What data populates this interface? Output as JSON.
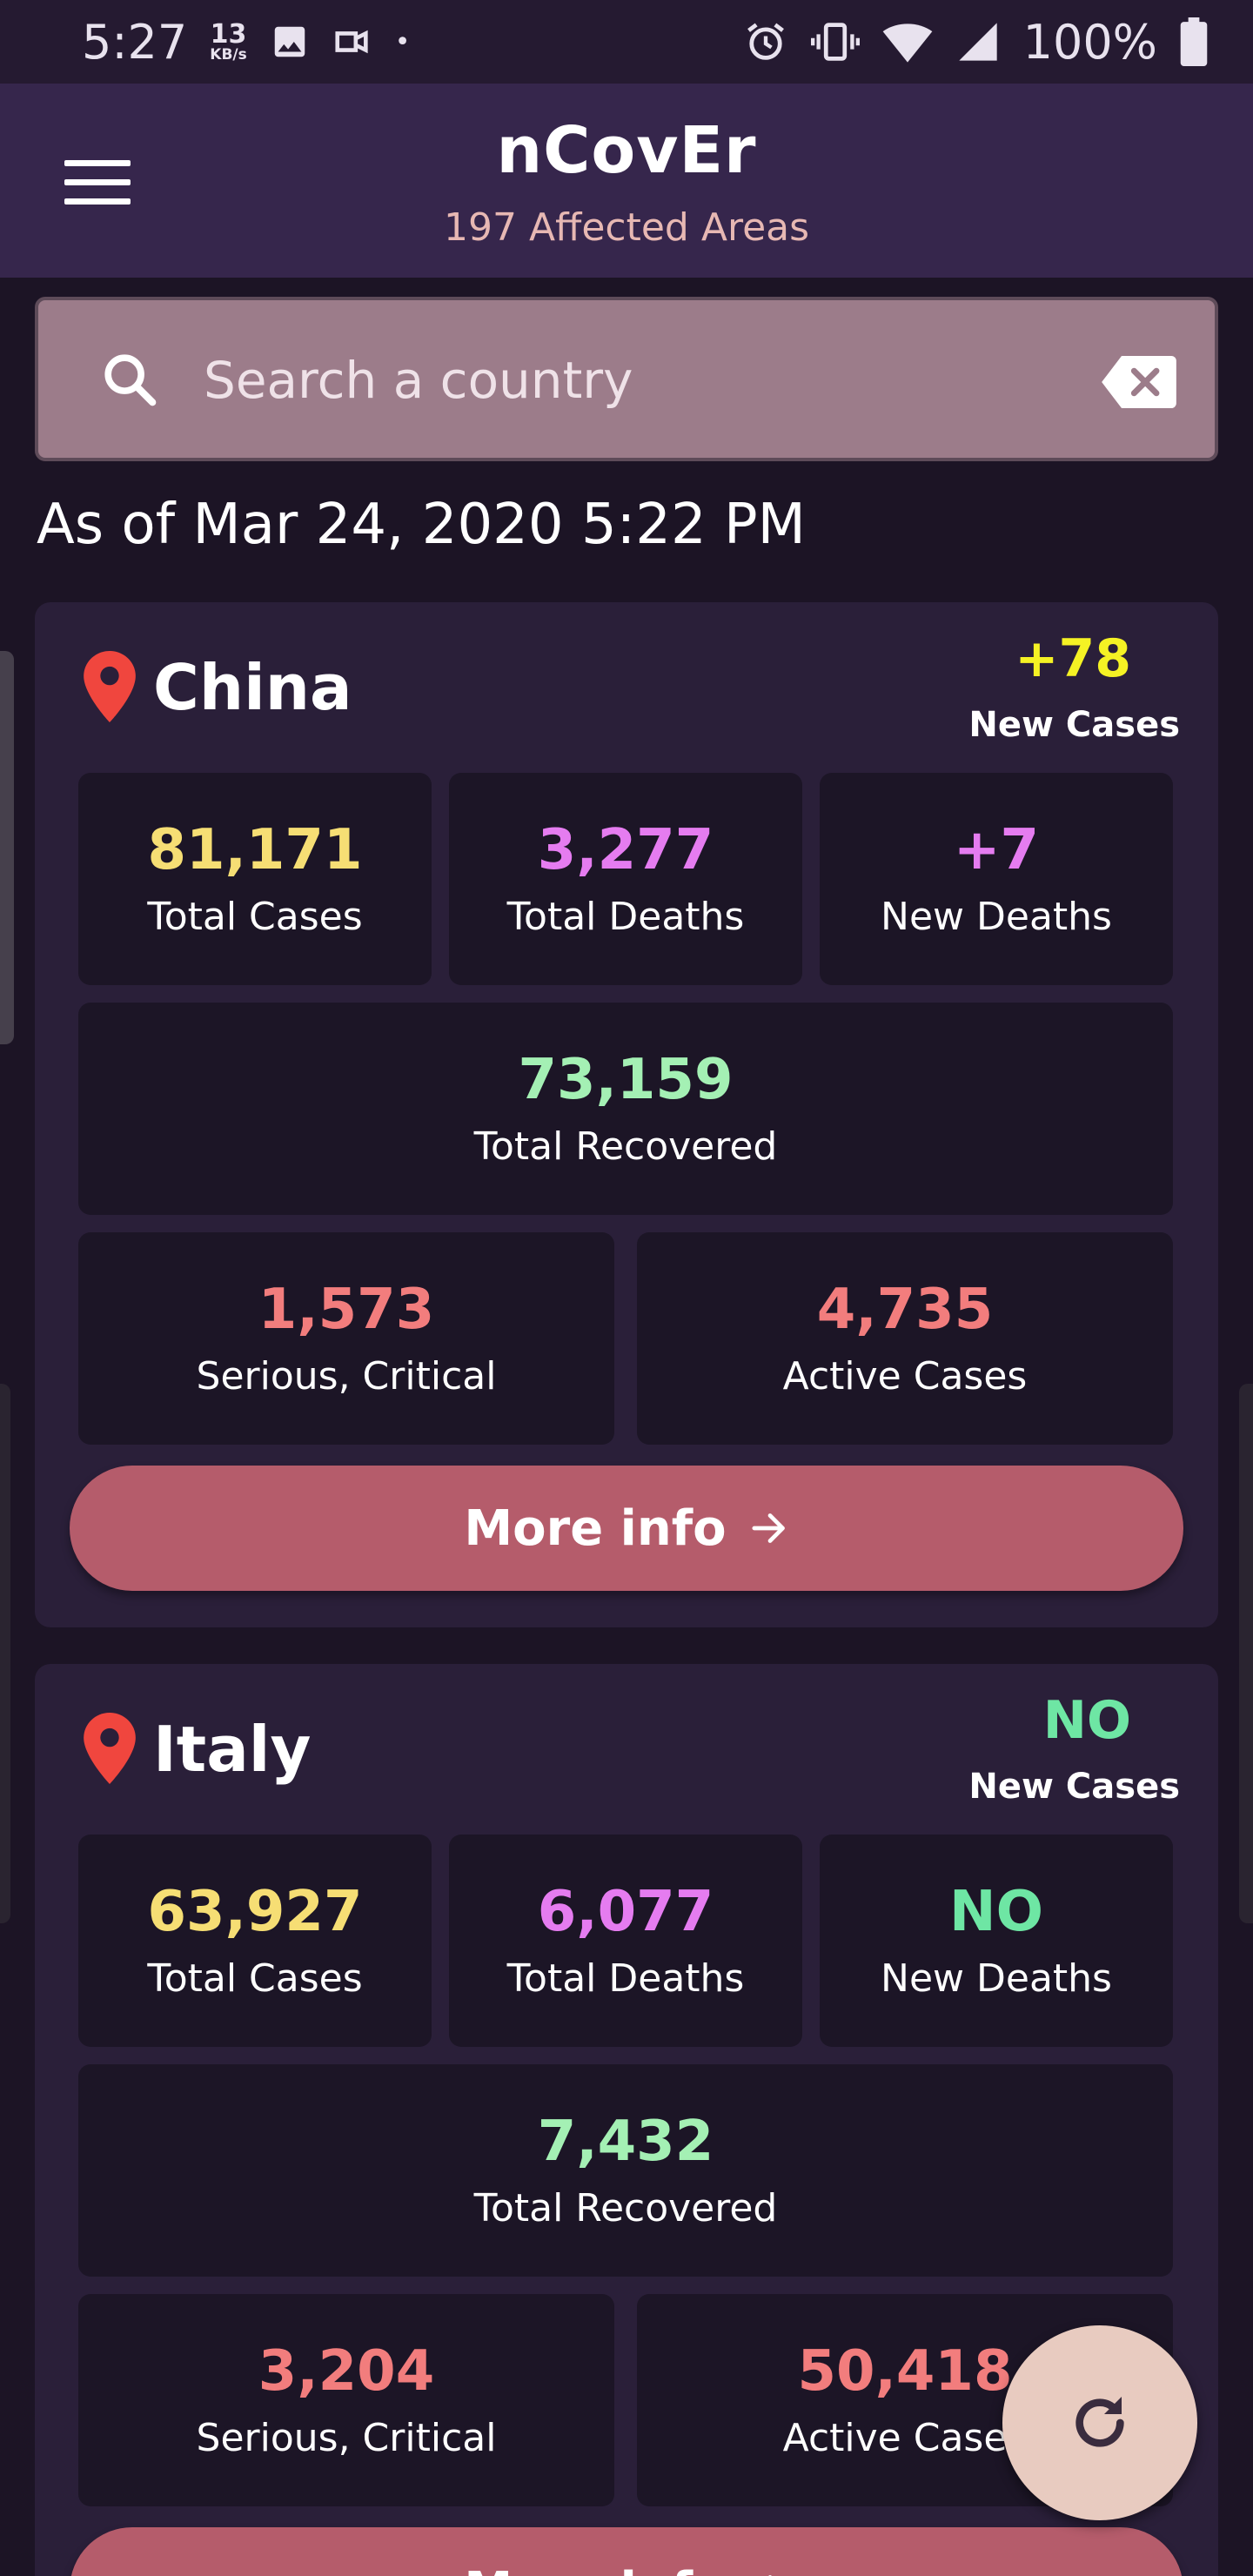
{
  "status_bar": {
    "time": "5:27",
    "speed_value": "13",
    "speed_unit": "KB/s",
    "dot": "•",
    "battery": "100%"
  },
  "app_bar": {
    "title": "nCovEr",
    "subtitle": "197 Affected Areas"
  },
  "search": {
    "placeholder": "Search a country"
  },
  "as_of": "As of Mar 24, 2020 5:22 PM",
  "colors": {
    "total_cases": "#f6de74",
    "total_deaths": "#e57cf0",
    "new_deaths": "#e57cf0",
    "recovered": "#a4f0b4",
    "serious": "#f27d7d",
    "active": "#f27d7d",
    "new_cases_positive": "#f5f224",
    "none": "#6ee6a4"
  },
  "countries": [
    {
      "name": "China",
      "new_cases": "+78",
      "new_cases_label": "New Cases",
      "total_cases": "81,171",
      "total_cases_label": "Total Cases",
      "total_deaths": "3,277",
      "total_deaths_label": "Total Deaths",
      "new_deaths": "+7",
      "new_deaths_label": "New Deaths",
      "total_recovered": "73,159",
      "total_recovered_label": "Total Recovered",
      "serious": "1,573",
      "serious_label": "Serious, Critical",
      "active": "4,735",
      "active_label": "Active Cases",
      "more_info": "More info"
    },
    {
      "name": "Italy",
      "new_cases": "NO",
      "new_cases_label": "New Cases",
      "total_cases": "63,927",
      "total_cases_label": "Total Cases",
      "total_deaths": "6,077",
      "total_deaths_label": "Total Deaths",
      "new_deaths": "NO",
      "new_deaths_label": "New Deaths",
      "total_recovered": "7,432",
      "total_recovered_label": "Total Recovered",
      "serious": "3,204",
      "serious_label": "Serious, Critical",
      "active": "50,418",
      "active_label": "Active Cases",
      "more_info": "More info"
    }
  ],
  "icons": {
    "menu": "hamburger-menu-icon",
    "search": "search-icon",
    "clear": "backspace-clear-icon",
    "pin": "location-pin-icon",
    "arrow": "arrow-right-icon",
    "refresh": "refresh-icon"
  }
}
